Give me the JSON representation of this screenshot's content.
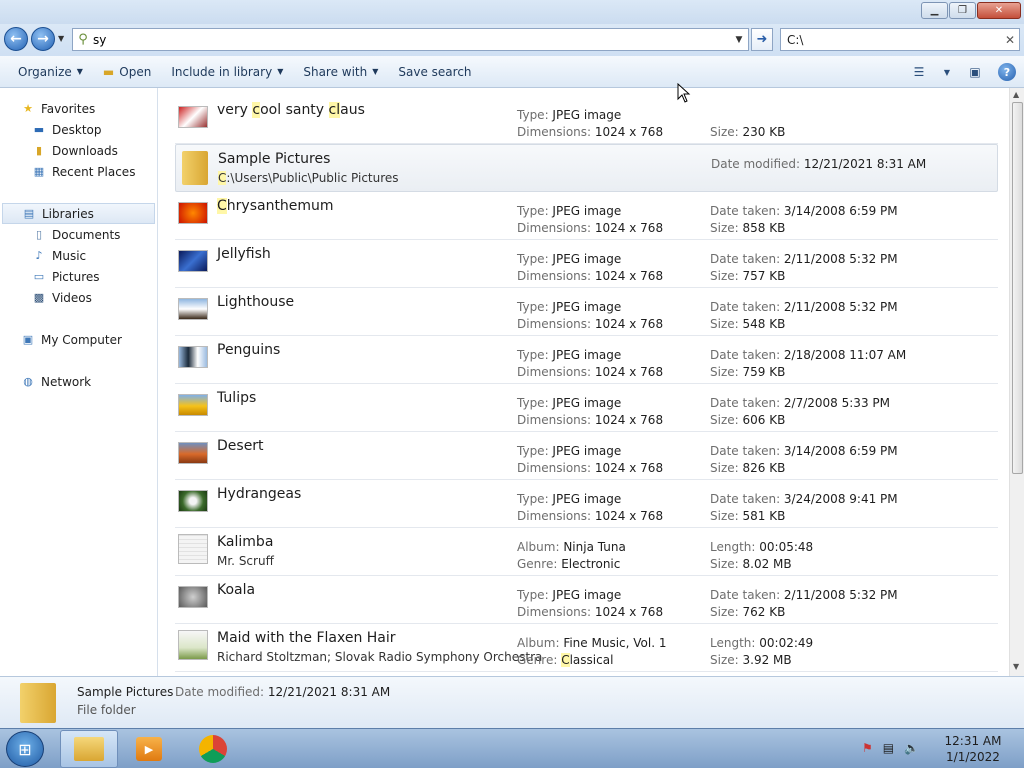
{
  "window": {
    "minimize_icon": "minimize-icon",
    "maximize_icon": "restore-icon",
    "close_icon": "close-icon"
  },
  "address": {
    "search_value": "sy",
    "path_value": "C:\\"
  },
  "toolbar": {
    "organize": "Organize",
    "open": "Open",
    "include": "Include in library",
    "share": "Share with",
    "save_search": "Save search"
  },
  "nav": {
    "favorites": "Favorites",
    "desktop": "Desktop",
    "downloads": "Downloads",
    "recent": "Recent Places",
    "libraries": "Libraries",
    "documents": "Documents",
    "music": "Music",
    "pictures": "Pictures",
    "videos": "Videos",
    "computer": "My Computer",
    "network": "Network"
  },
  "items": [
    {
      "pre": "very ",
      "hl": "c",
      "post": "ool santy ",
      "hl2": "cl",
      "post2": "aus",
      "l1": "Type: ",
      "v1": "JPEG image",
      "l2": "Dimensions: ",
      "v2": "1024 x 768",
      "l3": "",
      "v3": "",
      "l4": "Size: ",
      "v4": "230 KB"
    },
    {
      "name": "Sample Pictures",
      "sub_hl": "C",
      "sub": ":\\Users\\Public\\Public Pictures",
      "l3": "Date modified: ",
      "v3": "12/21/2021 8:31 AM"
    },
    {
      "hl": "C",
      "post": "hrysanthemum",
      "l1": "Type: ",
      "v1": "JPEG image",
      "l2": "Dimensions: ",
      "v2": "1024 x 768",
      "l3": "Date taken: ",
      "v3": "3/14/2008 6:59 PM",
      "l4": "Size: ",
      "v4": "858 KB"
    },
    {
      "name": "Jellyfish",
      "l1": "Type: ",
      "v1": "JPEG image",
      "l2": "Dimensions: ",
      "v2": "1024 x 768",
      "l3": "Date taken: ",
      "v3": "2/11/2008 5:32 PM",
      "l4": "Size: ",
      "v4": "757 KB"
    },
    {
      "name": "Lighthouse",
      "l1": "Type: ",
      "v1": "JPEG image",
      "l2": "Dimensions: ",
      "v2": "1024 x 768",
      "l3": "Date taken: ",
      "v3": "2/11/2008 5:32 PM",
      "l4": "Size: ",
      "v4": "548 KB"
    },
    {
      "name": "Penguins",
      "l1": "Type: ",
      "v1": "JPEG image",
      "l2": "Dimensions: ",
      "v2": "1024 x 768",
      "l3": "Date taken: ",
      "v3": "2/18/2008 11:07 AM",
      "l4": "Size: ",
      "v4": "759 KB"
    },
    {
      "name": "Tulips",
      "l1": "Type: ",
      "v1": "JPEG image",
      "l2": "Dimensions: ",
      "v2": "1024 x 768",
      "l3": "Date taken: ",
      "v3": "2/7/2008 5:33 PM",
      "l4": "Size: ",
      "v4": "606 KB"
    },
    {
      "name": "Desert",
      "l1": "Type: ",
      "v1": "JPEG image",
      "l2": "Dimensions: ",
      "v2": "1024 x 768",
      "l3": "Date taken: ",
      "v3": "3/14/2008 6:59 PM",
      "l4": "Size: ",
      "v4": "826 KB"
    },
    {
      "name": "Hydrangeas",
      "l1": "Type: ",
      "v1": "JPEG image",
      "l2": "Dimensions: ",
      "v2": "1024 x 768",
      "l3": "Date taken: ",
      "v3": "3/24/2008 9:41 PM",
      "l4": "Size: ",
      "v4": "581 KB"
    },
    {
      "name": "Kalimba",
      "sub": "Mr. Scruff",
      "l1": "Album: ",
      "v1": "Ninja Tuna",
      "l2": "Genre: ",
      "v2": "Electronic",
      "l3": "Length: ",
      "v3": "00:05:48",
      "l4": "Size: ",
      "v4": "8.02 MB"
    },
    {
      "name": "Koala",
      "l1": "Type: ",
      "v1": "JPEG image",
      "l2": "Dimensions: ",
      "v2": "1024 x 768",
      "l3": "Date taken: ",
      "v3": "2/11/2008 5:32 PM",
      "l4": "Size: ",
      "v4": "762 KB"
    },
    {
      "name": "Maid with the Flaxen Hair",
      "sub": "Richard Stoltzman; Slovak Radio Symphony Orchestra",
      "l1": "Album: ",
      "v1": "Fine Music, Vol. 1",
      "l2": "Genre: ",
      "v2_hl": "C",
      "v2": "lassical",
      "l3": "Length: ",
      "v3": "00:02:49",
      "l4": "Size: ",
      "v4": "3.92 MB"
    }
  ],
  "details": {
    "name": "Sample Pictures",
    "mod_label": "Date modified: ",
    "mod_value": "12/21/2021 8:31 AM",
    "type": "File folder"
  },
  "clock": {
    "time": "12:31 AM",
    "date": "1/1/2022"
  }
}
